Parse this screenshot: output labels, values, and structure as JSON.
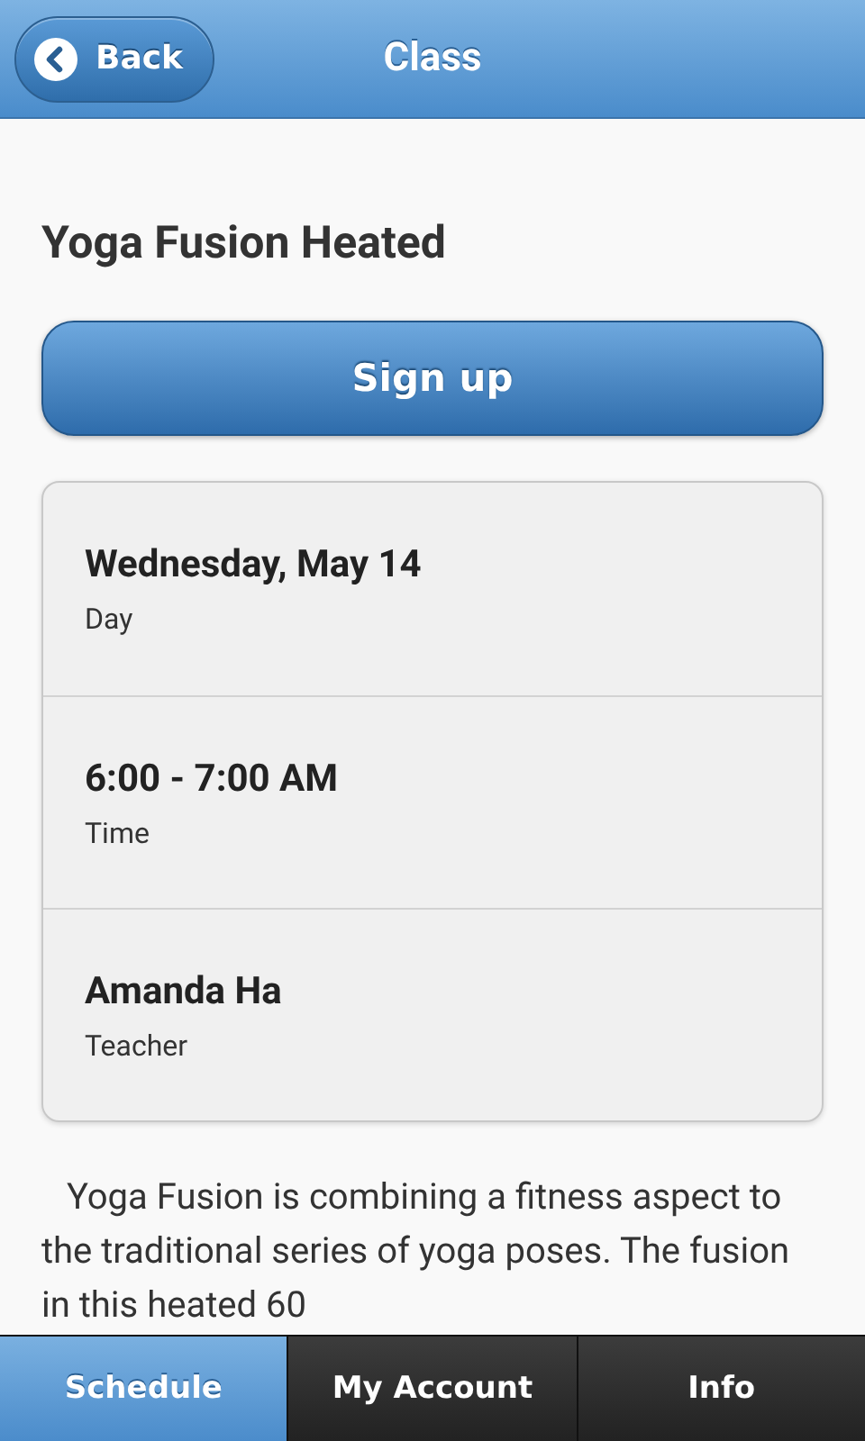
{
  "header": {
    "back": "Back",
    "title": "Class"
  },
  "class_title": "Yoga Fusion Heated",
  "signup": "Sign up",
  "details": [
    {
      "value": "Wednesday, May 14",
      "label": "Day"
    },
    {
      "value": "6:00 - 7:00 AM",
      "label": "Time"
    },
    {
      "value": "Amanda Ha",
      "label": "Teacher"
    }
  ],
  "description": "Yoga Fusion is combining a fitness aspect to the traditional series of yoga poses. The fusion in this heated 60",
  "tabs": [
    {
      "label": "Schedule",
      "selected": true
    },
    {
      "label": "My Account",
      "selected": false
    },
    {
      "label": "Info",
      "selected": false
    }
  ]
}
